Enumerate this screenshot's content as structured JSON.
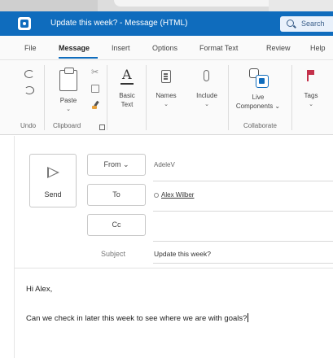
{
  "window": {
    "title": "Update this week? - Message (HTML)",
    "search_placeholder": "Search"
  },
  "menu": {
    "tabs": [
      "File",
      "Message",
      "Insert",
      "Options",
      "Format Text",
      "Review",
      "Help"
    ],
    "active_tab": "Message"
  },
  "ribbon": {
    "paste_label": "Paste",
    "basic_text_label": "Basic",
    "basic_text_label2": "Text",
    "names_label": "Names",
    "include_label": "Include",
    "live_components_label": "Live",
    "live_components_label2": "Components",
    "tags_label": "Tags",
    "groups": {
      "undo": "Undo",
      "clipboard": "Clipboard",
      "collaborate": "Collaborate"
    }
  },
  "compose": {
    "send_label": "Send",
    "from_label": "From",
    "from_value": "AdeleV",
    "to_label": "To",
    "to_value": "Alex Wilber",
    "cc_label": "Cc",
    "subject_label": "Subject",
    "subject_value": "Update this week?",
    "body_greeting": "Hi Alex,",
    "body_text": "Can we check in later this week to see where we are with goals?"
  },
  "colors": {
    "accent": "#0f6cbd",
    "titlebar_text": "#ffffff",
    "tag_flag": "#c4314b"
  },
  "icons": {
    "app": "outlook-app-icon",
    "search": "search-icon",
    "undo": "undo-icon",
    "redo": "redo-icon",
    "paste": "clipboard-paste-icon",
    "cut": "scissors-icon",
    "copy": "copy-icon",
    "format_painter": "format-painter-icon",
    "basic_text": "font-a-icon",
    "names": "address-book-icon",
    "include": "paperclip-icon",
    "live_components": "live-components-icon",
    "tags": "flag-icon",
    "send": "send-icon"
  }
}
